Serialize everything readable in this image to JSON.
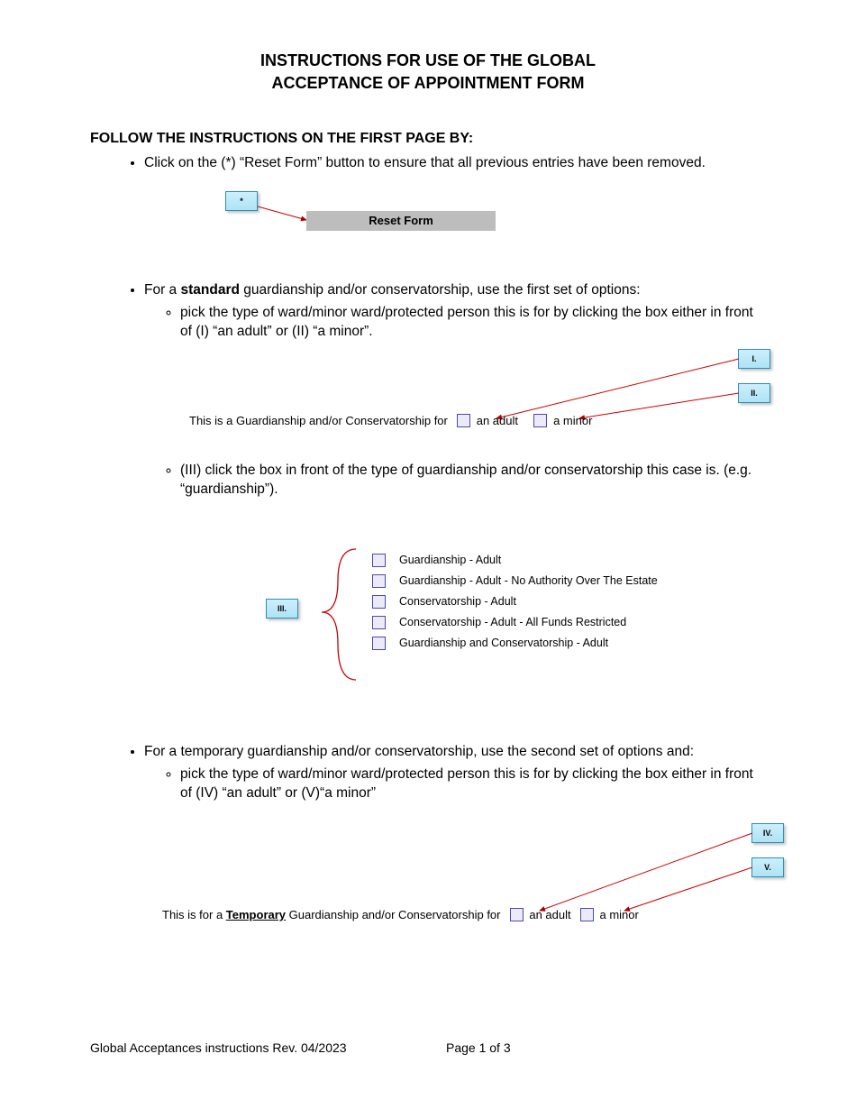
{
  "title_line1": "INSTRUCTIONS FOR USE OF THE GLOBAL",
  "title_line2": "ACCEPTANCE OF APPOINTMENT FORM",
  "section_heading": "FOLLOW THE INSTRUCTIONS ON THE FIRST PAGE BY:",
  "bullet1": "Click on the (*) “Reset Form” button to ensure that all previous entries have been removed.",
  "callout_star": "*",
  "reset_button_label": "Reset Form",
  "bullet2_pre": "For a ",
  "bullet2_bold": "standard",
  "bullet2_post": " guardianship and/or conservatorship, use the first set of options:",
  "bullet2_sub1": "pick the type of ward/minor ward/protected person this is for by clicking the box either in front of (I) “an adult” or (II) “a minor”.",
  "callout_I": "I.",
  "callout_II": "II.",
  "sentence_standard": "This is a Guardianship and/or Conservatorship for",
  "opt_adult": "an adult",
  "opt_minor": "a minor",
  "bullet2_sub2": "(III) click the box in front of the type of guardianship and/or conservatorship this case is. (e.g. “guardianship”).",
  "callout_III": "III.",
  "types": [
    "Guardianship - Adult",
    "Guardianship - Adult - No Authority Over The Estate",
    "Conservatorship - Adult",
    "Conservatorship - Adult - All Funds Restricted",
    "Guardianship and Conservatorship - Adult"
  ],
  "bullet3": "For a temporary guardianship and/or conservatorship, use the second set of options and:",
  "bullet3_sub1": "pick the type of ward/minor ward/protected person this is for by clicking the box either in front of (IV) “an adult” or (V)“a minor”",
  "callout_IV": "IV.",
  "callout_V": "V.",
  "sentence_temp_pre": "This is for a ",
  "sentence_temp_bold": "Temporary",
  "sentence_temp_post": " Guardianship and/or Conservatorship for",
  "footer_left": "Global Acceptances instructions Rev. 04/2023",
  "footer_center": "Page 1 of 3"
}
